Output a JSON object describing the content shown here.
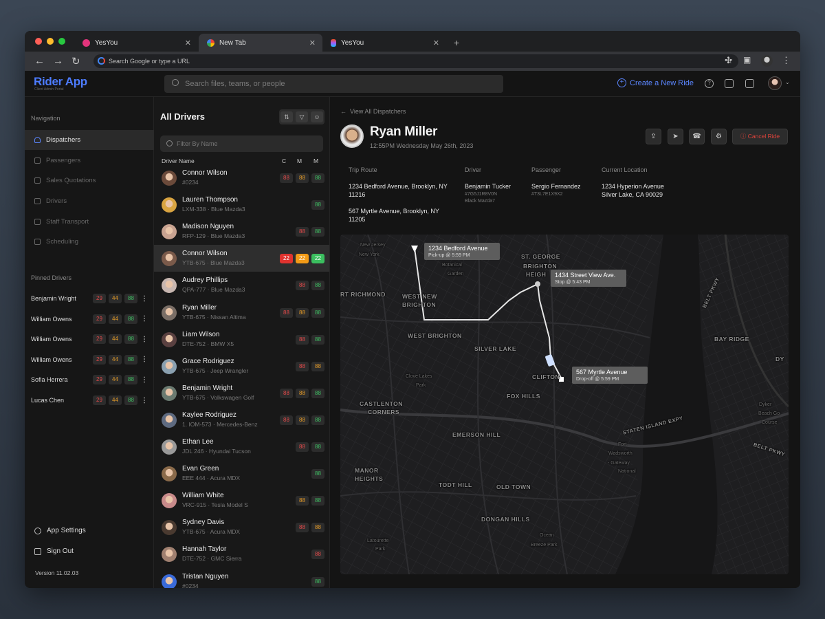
{
  "browser": {
    "tabs": [
      {
        "title": "YesYou",
        "icon": "yesyou-icon"
      },
      {
        "title": "New Tab",
        "icon": "google-icon"
      },
      {
        "title": "YesYou",
        "icon": "figma-icon"
      }
    ],
    "new_tab_symbol": "+",
    "address_placeholder": "Search Google or type a URL"
  },
  "app": {
    "title": "Rider App",
    "subtitle": "Client Admin Portal",
    "search_placeholder": "Search files, teams, or people",
    "create_label": "Create a New Ride",
    "accent_color": "#4d7cff"
  },
  "sidebar": {
    "nav_heading": "Navigation",
    "items": [
      {
        "label": "Dispatchers",
        "active": true,
        "icon": "user-icon"
      },
      {
        "label": "Passengers",
        "active": false,
        "icon": "users-icon"
      },
      {
        "label": "Sales Quotations",
        "active": false,
        "icon": "document-icon"
      },
      {
        "label": "Drivers",
        "active": false,
        "icon": "user-icon"
      },
      {
        "label": "Staff Transport",
        "active": false,
        "icon": "monitor-icon"
      },
      {
        "label": "Scheduling",
        "active": false,
        "icon": "calendar-icon"
      }
    ],
    "pinned_heading": "Pinned Drivers",
    "pinned": [
      {
        "name": "Benjamin Wright",
        "c": "29",
        "m1": "44",
        "m2": "88"
      },
      {
        "name": "William Owens",
        "c": "29",
        "m1": "44",
        "m2": "88"
      },
      {
        "name": "William Owens",
        "c": "29",
        "m1": "44",
        "m2": "88"
      },
      {
        "name": "William Owens",
        "c": "29",
        "m1": "44",
        "m2": "88"
      },
      {
        "name": "Sofia Herrera",
        "c": "29",
        "m1": "44",
        "m2": "88"
      },
      {
        "name": "Lucas Chen",
        "c": "29",
        "m1": "44",
        "m2": "88"
      }
    ],
    "settings_label": "App Settings",
    "signout_label": "Sign Out",
    "version": "Version 11.02.03"
  },
  "drivers": {
    "title": "All Drivers",
    "filter_placeholder": "Filter By Name",
    "col_name": "Driver Name",
    "col_c": "C",
    "col_m1": "M",
    "col_m2": "M",
    "rows": [
      {
        "name": "Connor Wilson",
        "sub": "#0234",
        "b": [
          [
            "88",
            "r"
          ],
          [
            "88",
            "o"
          ],
          [
            "88",
            "g"
          ]
        ]
      },
      {
        "name": "Lauren Thompson",
        "sub": "LXM-338 · Blue Mazda3",
        "b": [
          [
            "88",
            "g"
          ]
        ]
      },
      {
        "name": "Madison Nguyen",
        "sub": "RFP-129 · Blue Mazda3",
        "b": [
          [
            "88",
            "r"
          ],
          [
            "88",
            "g"
          ]
        ]
      },
      {
        "name": "Connor Wilson",
        "sub": "YTB-675 · Blue Mazda3",
        "b": [
          [
            "22",
            "rs"
          ],
          [
            "22",
            "os"
          ],
          [
            "22",
            "gs"
          ]
        ],
        "selected": true
      },
      {
        "name": "Audrey Phillips",
        "sub": "QPA-777 · Blue Mazda3",
        "b": [
          [
            "88",
            "r"
          ],
          [
            "88",
            "g"
          ]
        ]
      },
      {
        "name": "Ryan Miller",
        "sub": "YTB-675 · Nissan Altima",
        "b": [
          [
            "88",
            "r"
          ],
          [
            "88",
            "o"
          ],
          [
            "88",
            "g"
          ]
        ]
      },
      {
        "name": "Liam Wilson",
        "sub": "DTE-752 · BMW X5",
        "b": [
          [
            "88",
            "r"
          ],
          [
            "88",
            "g"
          ]
        ]
      },
      {
        "name": "Grace Rodriguez",
        "sub": "YTB-675 · Jeep Wrangler",
        "b": [
          [
            "88",
            "r"
          ],
          [
            "88",
            "o"
          ]
        ]
      },
      {
        "name": "Benjamin Wright",
        "sub": "YTB-675 · Volkswagen Golf",
        "b": [
          [
            "88",
            "r"
          ],
          [
            "88",
            "o"
          ],
          [
            "88",
            "g"
          ]
        ]
      },
      {
        "name": "Kaylee Rodriguez",
        "sub": "1. IOM-573 · Mercedes-Benz",
        "b": [
          [
            "88",
            "r"
          ],
          [
            "88",
            "o"
          ],
          [
            "88",
            "g"
          ]
        ]
      },
      {
        "name": "Ethan Lee",
        "sub": "JDL 246 · Hyundai Tucson",
        "b": [
          [
            "88",
            "r"
          ],
          [
            "88",
            "g"
          ]
        ]
      },
      {
        "name": "Evan Green",
        "sub": "EEE 444 · Acura MDX",
        "b": [
          [
            "88",
            "g"
          ]
        ]
      },
      {
        "name": "William White",
        "sub": "VRC-915 · Tesla Model S",
        "b": [
          [
            "88",
            "o"
          ],
          [
            "88",
            "g"
          ]
        ]
      },
      {
        "name": " Sydney Davis",
        "sub": "YTB-675 · Acura MDX",
        "b": [
          [
            "88",
            "r"
          ],
          [
            "88",
            "o"
          ]
        ]
      },
      {
        "name": "Hannah Taylor",
        "sub": "DTE-752 · GMC Sierra",
        "b": [
          [
            "88",
            "r"
          ]
        ]
      },
      {
        "name": "Tristan Nguyen",
        "sub": "#0234",
        "b": [
          [
            "88",
            "g"
          ]
        ]
      }
    ]
  },
  "detail": {
    "back_label": "View All Dispatchers",
    "name": "Ryan Miller",
    "datetime": "12:55PM Wednesday May 26th, 2023",
    "cancel_label": "Cancel Ride",
    "trip_route_label": "Trip Route",
    "route_from": "1234 Bedford Avenue, Brooklyn, NY 11216",
    "route_to": "567 Myrtle Avenue, Brooklyn, NY 11205",
    "driver_label": "Driver",
    "driver_name": "Benjamin Tucker",
    "driver_id": "#7G5J1R8V0N",
    "driver_car": "Black Mazda7",
    "passenger_label": "Passenger",
    "passenger_name": "Sergio Fernandez",
    "passenger_id": "#T3L7E1X9X2",
    "location_label": "Current Location",
    "location_value": "1234 Hyperion Avenue Silver Lake, CA 90029"
  },
  "map": {
    "pickup_title": "1234 Bedford Avenue",
    "pickup_sub": "Pick-up @ 5:59 PM",
    "stop_title": "1434 Street View Ave.",
    "stop_sub": "Stop @ 5:43 PM",
    "dropoff_title": "567 Myrtle Avenue",
    "dropoff_sub": "Drop-off @ 5:59 PM",
    "labels": [
      "ST. GEORGE",
      "BRIGHTON",
      "HEIGH",
      "WEST NEW",
      "BRIGHTON",
      "RT RICHMOND",
      "WEST BRIGHTON",
      "SILVER LAKE",
      "CLIFTON",
      "FOX HILLS",
      "CASTLENTON",
      "CORNERS",
      "EMERSON HILL",
      "MANOR",
      "HEIGHTS",
      "TODT HILL",
      "OLD TOWN",
      "DONGAN HILLS",
      "BAY RIDGE",
      "DY",
      "Fort",
      "Wadsworth",
      "- Gateway",
      "National",
      "STATEN ISLAND EXPY",
      "BELT PKWY",
      "BELT PKWY",
      "Clove Lakes",
      "Park",
      "Latourette",
      "Park",
      "Ocean",
      "Breeze Park",
      "Dyker",
      "Beach Go",
      "Course",
      "New Jersey",
      "New York",
      "Botanical",
      "Garden"
    ]
  }
}
